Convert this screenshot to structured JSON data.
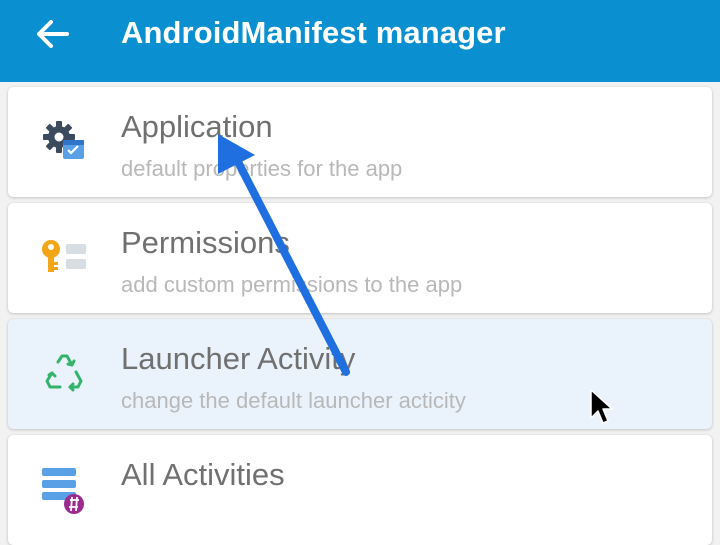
{
  "app_bar": {
    "title": "AndroidManifest manager",
    "back_icon": "arrow-left-icon",
    "color": "#0a8fd0"
  },
  "items": [
    {
      "title": "Application",
      "subtitle": "default properties for the app",
      "icon": "gear-settings-icon"
    },
    {
      "title": "Permissions",
      "subtitle": "add custom permissions to the app",
      "icon": "key-icon"
    },
    {
      "title": "Launcher Activity",
      "subtitle": "change the default launcher acticity",
      "icon": "recycle-icon",
      "selected": true
    },
    {
      "title": "All Activities",
      "subtitle": "",
      "icon": "list-hash-icon"
    }
  ],
  "annotation": {
    "arrow_color": "#1f6fe0",
    "arrow_icon": "annotation-arrow-icon",
    "cursor_icon": "mouse-pointer-icon"
  }
}
